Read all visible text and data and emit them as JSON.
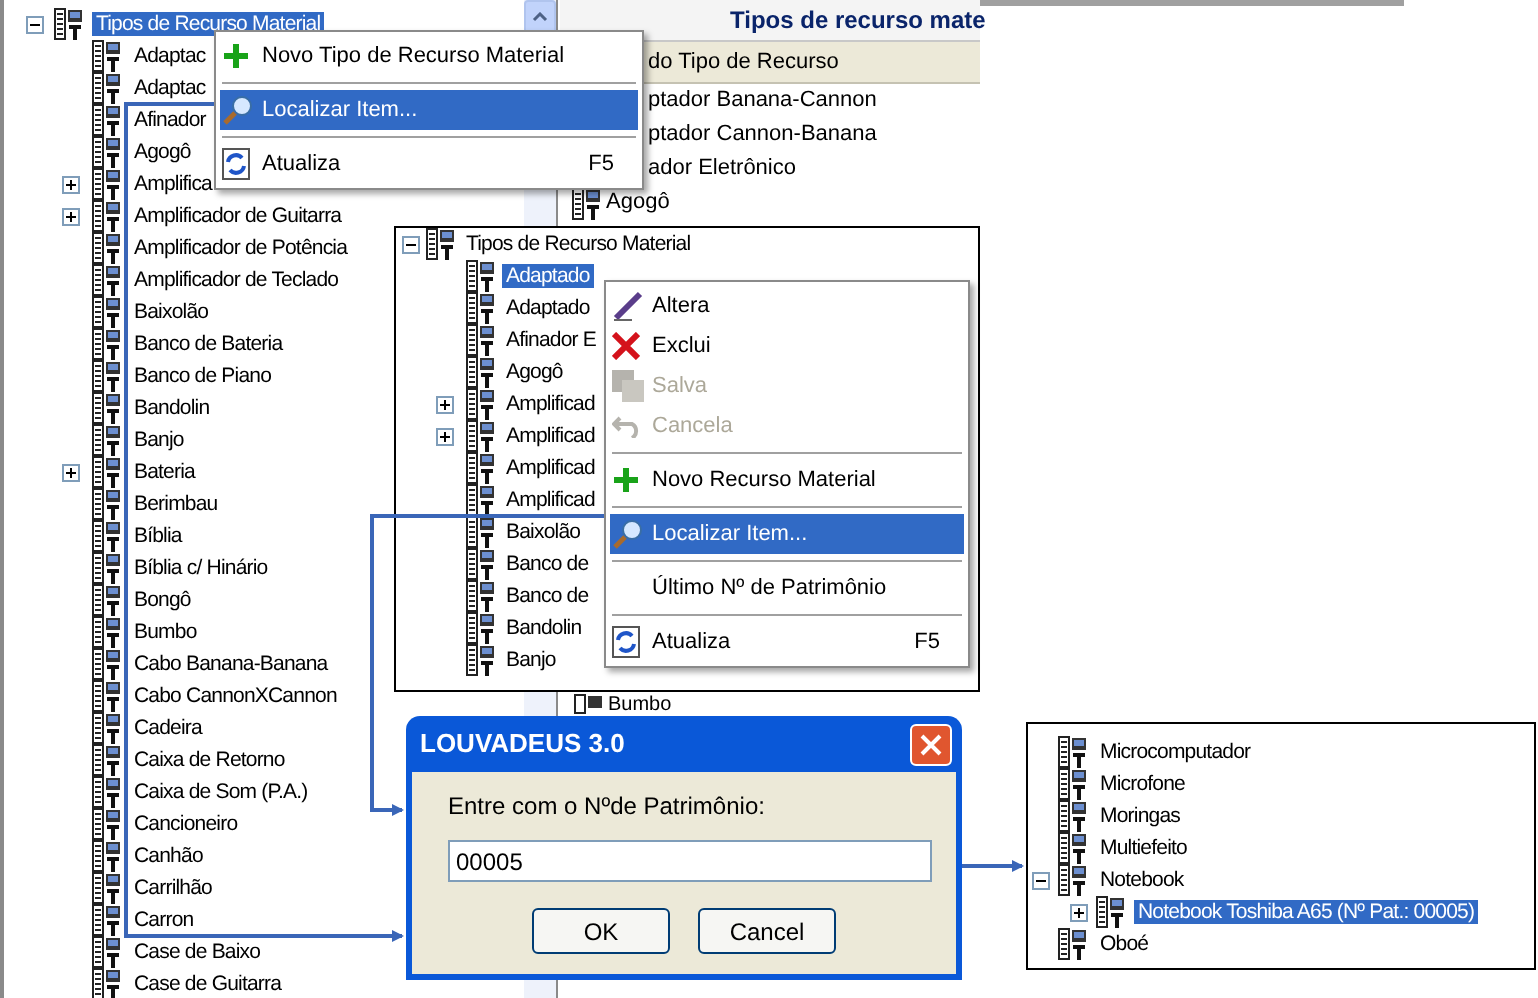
{
  "main_tree": {
    "root": {
      "label": "Tipos de Recurso Material",
      "selected": true,
      "expanded": true
    },
    "items": [
      {
        "label": "Adaptac",
        "selected": false
      },
      {
        "label": "Adaptac",
        "selected": false
      },
      {
        "label": "Afinador",
        "selected": false
      },
      {
        "label": "Agogô",
        "selected": false
      },
      {
        "label": "Amplifica",
        "selected": false,
        "expanded": false
      },
      {
        "label": "Amplificador de Guitarra",
        "selected": false,
        "expanded": false
      },
      {
        "label": "Amplificador de Potência",
        "selected": false
      },
      {
        "label": "Amplificador de Teclado",
        "selected": false
      },
      {
        "label": "Baixolão",
        "selected": false
      },
      {
        "label": "Banco de Bateria",
        "selected": false
      },
      {
        "label": "Banco de Piano",
        "selected": false
      },
      {
        "label": "Bandolin",
        "selected": false
      },
      {
        "label": "Banjo",
        "selected": false
      },
      {
        "label": "Bateria",
        "selected": false,
        "expanded": false
      },
      {
        "label": "Berimbau",
        "selected": false
      },
      {
        "label": "Bíblia",
        "selected": false
      },
      {
        "label": "Bíblia c/ Hinário",
        "selected": false
      },
      {
        "label": "Bongô",
        "selected": false
      },
      {
        "label": "Bumbo",
        "selected": false
      },
      {
        "label": "Cabo Banana-Banana",
        "selected": false
      },
      {
        "label": "Cabo CannonXCannon",
        "selected": false
      },
      {
        "label": "Cadeira",
        "selected": false
      },
      {
        "label": "Caixa de Retorno",
        "selected": false
      },
      {
        "label": "Caixa de Som (P.A.)",
        "selected": false
      },
      {
        "label": "Cancioneiro",
        "selected": false
      },
      {
        "label": "Canhão",
        "selected": false
      },
      {
        "label": "Carrilhão",
        "selected": false
      },
      {
        "label": "Carron",
        "selected": false
      },
      {
        "label": "Case de Baixo",
        "selected": false
      },
      {
        "label": "Case de Guitarra",
        "selected": false
      }
    ]
  },
  "list_panel": {
    "title": "Tipos de recurso mate",
    "column_header": "do Tipo de Recurso",
    "rows": [
      "ptador Banana-Cannon",
      "ptador Cannon-Banana",
      "ador Eletrônico"
    ],
    "icon_row": "Agogô",
    "bottom_row": "Bumbo"
  },
  "menu_1": {
    "items": [
      {
        "kind": "add",
        "label": "Novo Tipo de Recurso Material",
        "selected": false
      },
      {
        "kind": "separator"
      },
      {
        "kind": "search",
        "label": "Localizar Item...",
        "selected": true
      },
      {
        "kind": "separator"
      },
      {
        "kind": "refresh",
        "label": "Atualiza",
        "shortcut": "F5",
        "selected": false
      }
    ]
  },
  "second_tree": {
    "root": {
      "label": "Tipos de Recurso Material",
      "selected": false,
      "expanded": true
    },
    "items": [
      {
        "label": "Adaptado",
        "selected": true
      },
      {
        "label": "Adaptado",
        "selected": false
      },
      {
        "label": "Afinador E",
        "selected": false
      },
      {
        "label": "Agogô",
        "selected": false
      },
      {
        "label": "Amplificad",
        "selected": false,
        "expanded": false
      },
      {
        "label": "Amplificad",
        "selected": false,
        "expanded": false
      },
      {
        "label": "Amplificad",
        "selected": false
      },
      {
        "label": "Amplificad",
        "selected": false
      },
      {
        "label": "Baixolão",
        "selected": false
      },
      {
        "label": "Banco de",
        "selected": false
      },
      {
        "label": "Banco de",
        "selected": false
      },
      {
        "label": "Bandolin",
        "selected": false
      },
      {
        "label": "Banjo",
        "selected": false
      }
    ]
  },
  "menu_2": {
    "items": [
      {
        "kind": "edit",
        "label": "Altera",
        "selected": false,
        "disabled": false
      },
      {
        "kind": "delete",
        "label": "Exclui",
        "selected": false,
        "disabled": false
      },
      {
        "kind": "save",
        "label": "Salva",
        "selected": false,
        "disabled": true
      },
      {
        "kind": "undo",
        "label": "Cancela",
        "selected": false,
        "disabled": true
      },
      {
        "kind": "separator"
      },
      {
        "kind": "add",
        "label": "Novo Recurso Material",
        "selected": false,
        "disabled": false
      },
      {
        "kind": "separator"
      },
      {
        "kind": "search",
        "label": "Localizar Item...",
        "selected": true,
        "disabled": false
      },
      {
        "kind": "separator"
      },
      {
        "kind": "plain",
        "label": "Último Nº de Patrimônio",
        "selected": false,
        "disabled": false
      },
      {
        "kind": "separator"
      },
      {
        "kind": "refresh",
        "label": "Atualiza",
        "shortcut": "F5",
        "selected": false,
        "disabled": false
      }
    ]
  },
  "dialog": {
    "title": "LOUVADEUS 3.0",
    "label": "Entre com o Nºde Patrimônio:",
    "value": "00005",
    "buttons": [
      "OK",
      "Cancel"
    ]
  },
  "result_tree": {
    "items": [
      {
        "label": "Microcomputador",
        "selected": false
      },
      {
        "label": "Microfone",
        "selected": false
      },
      {
        "label": "Moringas",
        "selected": false
      },
      {
        "label": "Multiefeito",
        "selected": false
      },
      {
        "label": "Notebook",
        "selected": false,
        "expanded": true,
        "children": [
          {
            "label": "Notebook Toshiba A65 (Nº Pat.: 00005)",
            "selected": true,
            "expanded": false
          }
        ]
      },
      {
        "label": "Oboé",
        "selected": false
      }
    ]
  }
}
